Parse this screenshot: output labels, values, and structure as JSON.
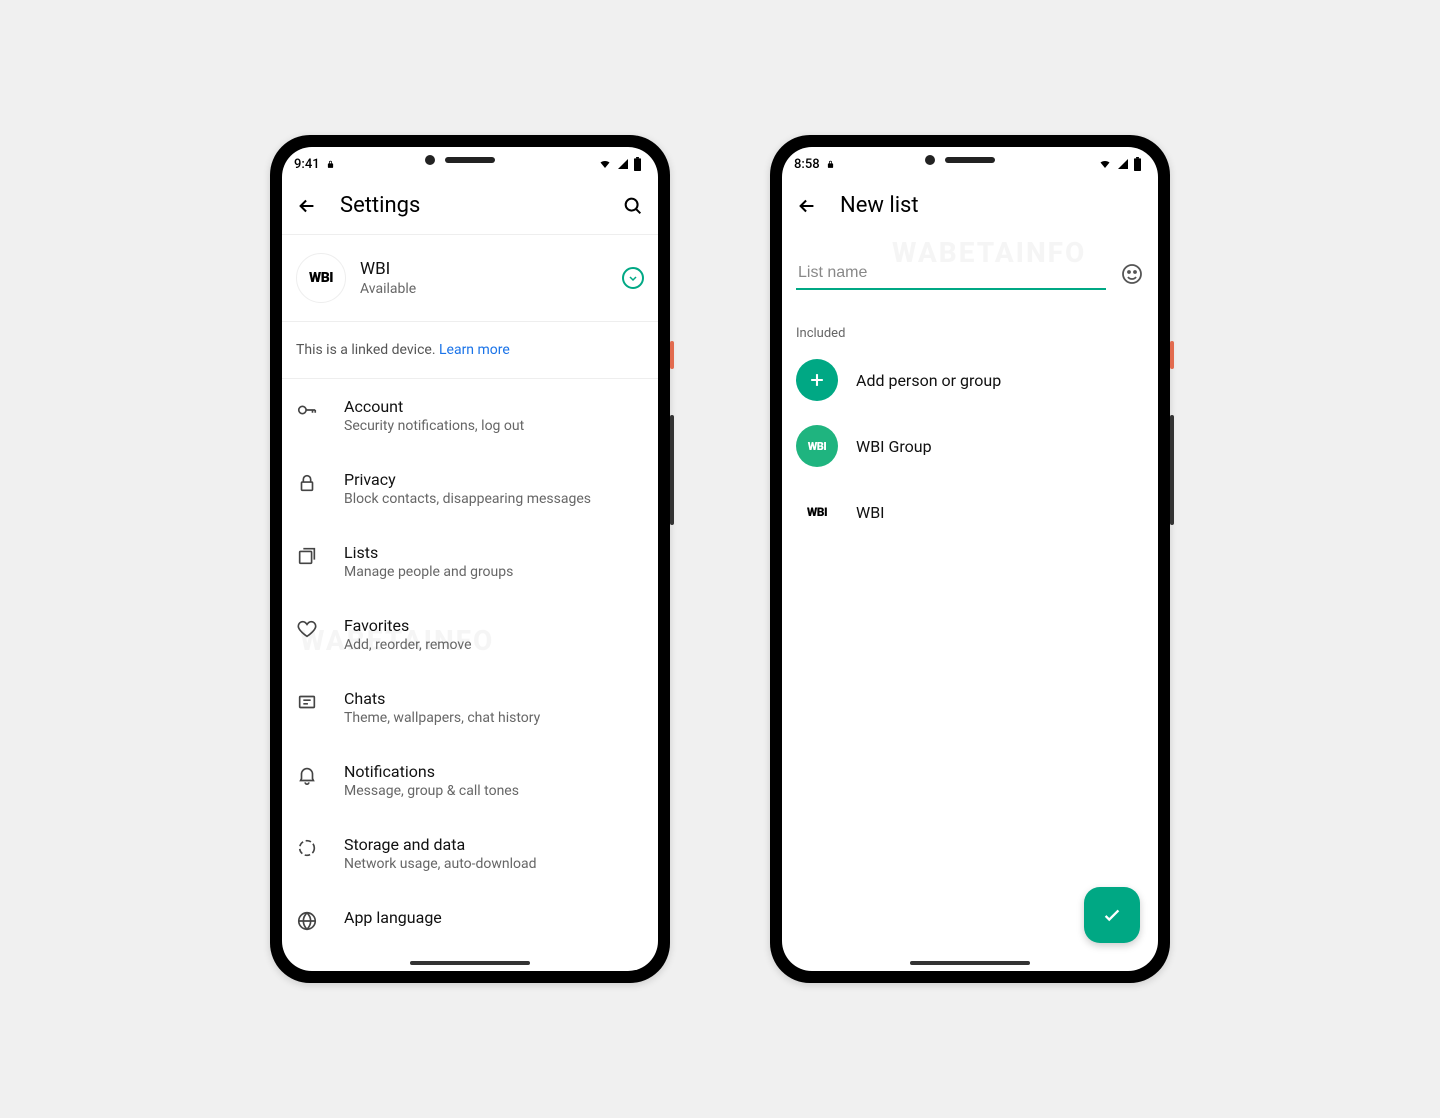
{
  "left": {
    "status_time": "9:41",
    "app_title": "Settings",
    "profile": {
      "name": "WBI",
      "status": "Available",
      "avatar_text": "WBI"
    },
    "linked_text": "This is a linked device. ",
    "linked_link": "Learn more",
    "items": [
      {
        "icon": "key",
        "title": "Account",
        "sub": "Security notifications, log out"
      },
      {
        "icon": "lock",
        "title": "Privacy",
        "sub": "Block contacts, disappearing messages"
      },
      {
        "icon": "list",
        "title": "Lists",
        "sub": "Manage people and groups"
      },
      {
        "icon": "heart",
        "title": "Favorites",
        "sub": "Add, reorder, remove"
      },
      {
        "icon": "chat",
        "title": "Chats",
        "sub": "Theme, wallpapers, chat history"
      },
      {
        "icon": "bell",
        "title": "Notifications",
        "sub": "Message, group & call tones"
      },
      {
        "icon": "storage",
        "title": "Storage and data",
        "sub": "Network usage, auto-download"
      },
      {
        "icon": "globe",
        "title": "App language",
        "sub": ""
      }
    ]
  },
  "right": {
    "status_time": "8:58",
    "app_title": "New list",
    "input_placeholder": "List name",
    "section_label": "Included",
    "items": [
      {
        "type": "add",
        "label": "Add person or group"
      },
      {
        "type": "group",
        "label": "WBI Group",
        "avatar_text": "WBI"
      },
      {
        "type": "contact",
        "label": "WBI",
        "avatar_text": "WBI"
      }
    ]
  },
  "watermark": "WABETAINFO"
}
